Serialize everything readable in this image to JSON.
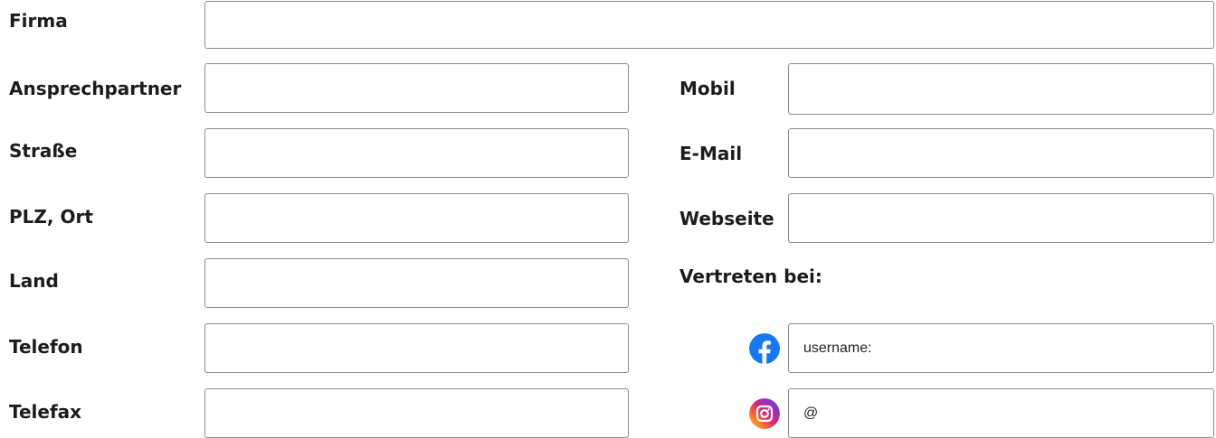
{
  "form": {
    "firma": {
      "label": "Firma",
      "value": "",
      "placeholder": ""
    },
    "ansprechpartner": {
      "label": "Ansprechpartner",
      "value": "",
      "placeholder": ""
    },
    "strasse": {
      "label": "Straße",
      "value": "",
      "placeholder": ""
    },
    "plz_ort": {
      "label": "PLZ, Ort",
      "value": "",
      "placeholder": ""
    },
    "land": {
      "label": "Land",
      "value": "",
      "placeholder": ""
    },
    "telefon": {
      "label": "Telefon",
      "value": "",
      "placeholder": ""
    },
    "telefax": {
      "label": "Telefax",
      "value": "",
      "placeholder": ""
    },
    "mobil": {
      "label": "Mobil",
      "value": "",
      "placeholder": ""
    },
    "email": {
      "label": "E-Mail",
      "value": "",
      "placeholder": ""
    },
    "webseite": {
      "label": "Webseite",
      "value": "",
      "placeholder": ""
    }
  },
  "social": {
    "heading": "Vertreten bei:",
    "facebook": {
      "icon": "facebook-icon",
      "placeholder": "username:",
      "value": ""
    },
    "instagram": {
      "icon": "instagram-icon",
      "placeholder": "@",
      "value": ""
    }
  },
  "colors": {
    "facebook_blue": "#1877f2",
    "instagram_gradient": [
      "#feda75",
      "#fa7e1e",
      "#d62976",
      "#962fbf",
      "#4f5bd5"
    ],
    "border": "#8c8c8c"
  }
}
